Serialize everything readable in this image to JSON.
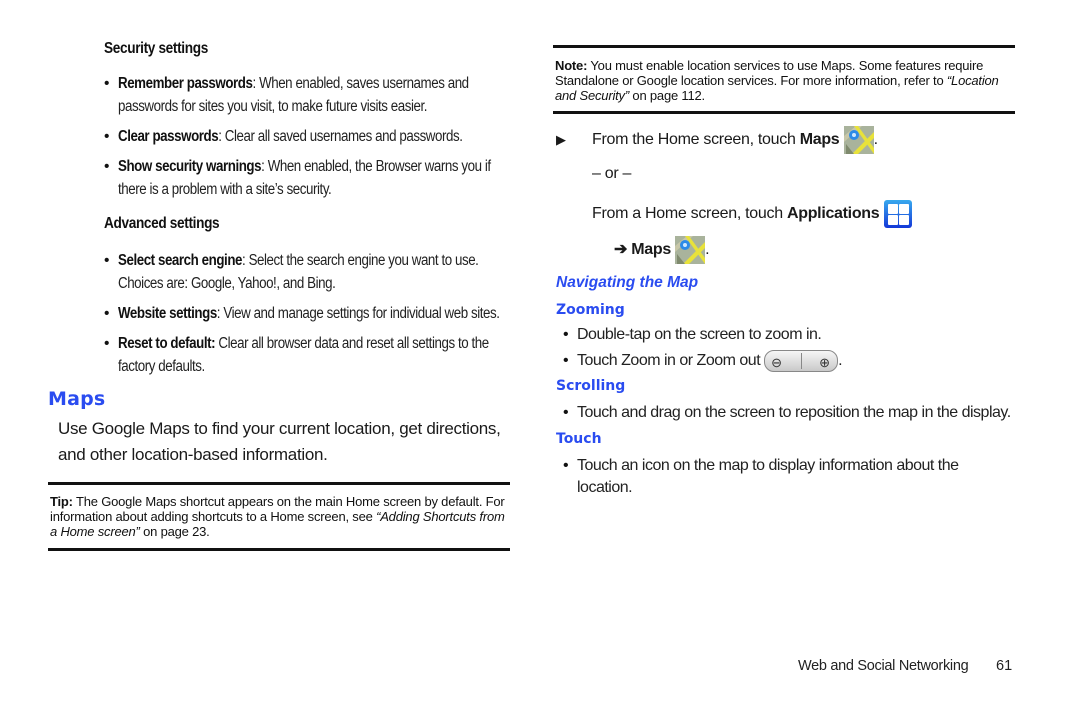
{
  "left": {
    "security": {
      "heading": "Security settings",
      "items": [
        {
          "term": "Remember passwords",
          "sep": ": ",
          "text": "When enabled, saves usernames and passwords for sites you visit, to make future visits easier."
        },
        {
          "term": "Clear passwords",
          "sep": ": ",
          "text": "Clear all saved usernames and passwords."
        },
        {
          "term": "Show security warnings",
          "sep": ": ",
          "text": "When enabled, the Browser warns you if there is a problem with a site’s security."
        }
      ]
    },
    "advanced": {
      "heading": "Advanced settings",
      "items": [
        {
          "term": "Select search engine",
          "sep": ": ",
          "text": "Select the search engine you want to use. Choices are: Google, Yahoo!, and Bing."
        },
        {
          "term": "Website settings",
          "sep": ": ",
          "text": "View and manage settings for individual web sites."
        },
        {
          "term": "Reset to default:",
          "sep": " ",
          "text": "Clear all browser data and reset all settings to the factory defaults."
        }
      ]
    },
    "maps": {
      "heading": "Maps",
      "intro": "Use Google Maps to find your current location, get directions, and other location-based information."
    },
    "tip": {
      "label": "Tip:",
      "text": "The Google Maps shortcut appears on the main Home screen by default. For information about adding shortcuts to a Home screen, see",
      "link": "“Adding Shortcuts from a Home screen”",
      "suffix": "on page 23."
    }
  },
  "right": {
    "note": {
      "label": "Note:",
      "text": "You must enable location services to use Maps. Some features require Standalone or Google location services. For more information, refer to",
      "link": "“Location and Security”",
      "suffix": "on page 112."
    },
    "steps": {
      "line1_prefix": "From the Home screen, touch",
      "line1_bold": "Maps",
      "or": "– or –",
      "line2_prefix": "From a Home screen, touch",
      "line2_bold": "Applications",
      "line3_arrow": "➔",
      "line3_bold": "Maps",
      "period": "."
    },
    "navigating": {
      "heading": "Navigating the Map",
      "zooming": {
        "heading": "Zooming",
        "items": [
          "Double-tap on the screen to zoom in.",
          "Touch Zoom in or Zoom out"
        ]
      },
      "scrolling": {
        "heading": "Scrolling",
        "items": [
          "Touch and drag on the screen to reposition the map in the display."
        ]
      },
      "touch": {
        "heading": "Touch",
        "items": [
          "Touch an icon on the map to display information about the location."
        ]
      }
    }
  },
  "footer": {
    "section": "Web and Social Networking",
    "page": "61"
  },
  "colors": {
    "heading_blue": "#2a4cf0",
    "rule": "#111111"
  }
}
